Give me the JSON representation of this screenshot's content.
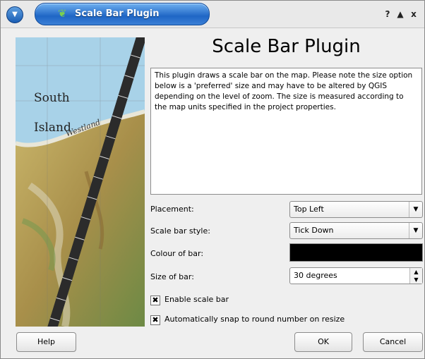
{
  "window": {
    "title": "Scale Bar Plugin",
    "buttons": {
      "help": "?",
      "shade": "▲",
      "close": "x"
    }
  },
  "heading": "Scale Bar Plugin",
  "description": "This plugin draws a scale bar on the map. Please note the size option below is a 'preferred' size and may have to be altered by QGIS depending on the level of zoom.  The size is measured according to the map units specified in the project properties.",
  "map_labels": {
    "region1": "South",
    "region2": "Island",
    "coast": "Westland"
  },
  "form": {
    "placement_label": "Placement:",
    "placement_value": "Top Left",
    "style_label": "Scale bar style:",
    "style_value": "Tick Down",
    "colour_label": "Colour of bar:",
    "colour_value": "#000000",
    "size_label": "Size of bar:",
    "size_value": "30 degrees",
    "enable_label": "Enable scale bar",
    "enable_checked": true,
    "snap_label": "Automatically snap to round number on resize",
    "snap_checked": true
  },
  "buttons": {
    "help": "Help",
    "ok": "OK",
    "cancel": "Cancel"
  }
}
